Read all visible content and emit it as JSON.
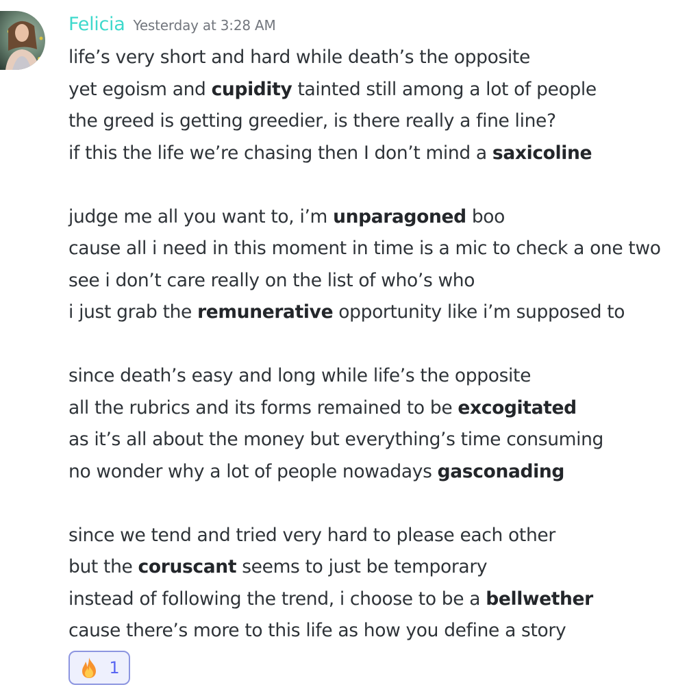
{
  "message": {
    "author": "Felicia",
    "timestamp": "Yesterday at 3:28 AM",
    "author_color": "#3ed9cc",
    "lines": [
      [
        {
          "t": "life’s very short and hard while death’s the opposite"
        }
      ],
      [
        {
          "t": "yet egoism and "
        },
        {
          "t": "cupidity",
          "b": true
        },
        {
          "t": " tainted still among a lot of people"
        }
      ],
      [
        {
          "t": "the greed is getting greedier, is there really a fine line?"
        }
      ],
      [
        {
          "t": "if this the life we’re chasing then I don’t mind a "
        },
        {
          "t": "saxicoline",
          "b": true
        }
      ],
      [],
      [
        {
          "t": "judge me all you want to, i’m "
        },
        {
          "t": "unparagoned",
          "b": true
        },
        {
          "t": " boo"
        }
      ],
      [
        {
          "t": "cause all i need in this moment in time is a mic to check a one two"
        }
      ],
      [
        {
          "t": "see i don’t care really on the list of who’s who"
        }
      ],
      [
        {
          "t": "i just grab the "
        },
        {
          "t": "remunerative",
          "b": true
        },
        {
          "t": " opportunity like i’m supposed to"
        }
      ],
      [],
      [
        {
          "t": "since death’s easy and long while life’s the opposite"
        }
      ],
      [
        {
          "t": "all the rubrics and its forms remained to be "
        },
        {
          "t": "excogitated",
          "b": true
        }
      ],
      [
        {
          "t": "as it’s all about the money but everything’s time consuming"
        }
      ],
      [
        {
          "t": "no wonder why a lot of people nowadays "
        },
        {
          "t": "gasconading",
          "b": true
        }
      ],
      [],
      [
        {
          "t": "since we tend and tried very hard to please each other"
        }
      ],
      [
        {
          "t": "but the "
        },
        {
          "t": "coruscant",
          "b": true
        },
        {
          "t": " seems to just be temporary"
        }
      ],
      [
        {
          "t": "instead of following the trend, i choose to be a "
        },
        {
          "t": "bellwether",
          "b": true
        }
      ],
      [
        {
          "t": "cause there’s more to this life as how you define a story"
        }
      ]
    ]
  },
  "reaction": {
    "emoji": "fire-emoji",
    "count": "1",
    "accent": "#5865f2"
  }
}
